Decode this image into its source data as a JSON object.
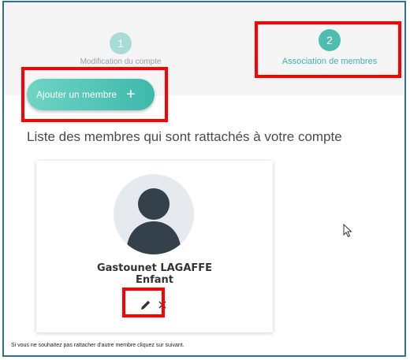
{
  "stepper": {
    "steps": [
      {
        "number": "1",
        "label": "Modification du compte",
        "state": "completed"
      },
      {
        "number": "2",
        "label": "Association de membres",
        "state": "active"
      }
    ]
  },
  "actions": {
    "add_member_label": "Ajouter un membre",
    "add_icon": "plus-icon"
  },
  "members_section": {
    "title": "Liste des membres qui sont rattachés à votre compte",
    "members": [
      {
        "name": "Gastounet LAGAFFE",
        "role": "Enfant",
        "avatar": "person-placeholder",
        "actions": [
          "edit-icon",
          "remove-icon"
        ]
      }
    ]
  },
  "footer": {
    "hint": "Si vous ne souhaitez pas rattacher d'autre membre cliquez sur suivant."
  },
  "colors": {
    "accent": "#4dbdb0",
    "accent_light": "#a8dcd5",
    "highlight": "#ff0000",
    "frame": "#2f6fa0"
  }
}
